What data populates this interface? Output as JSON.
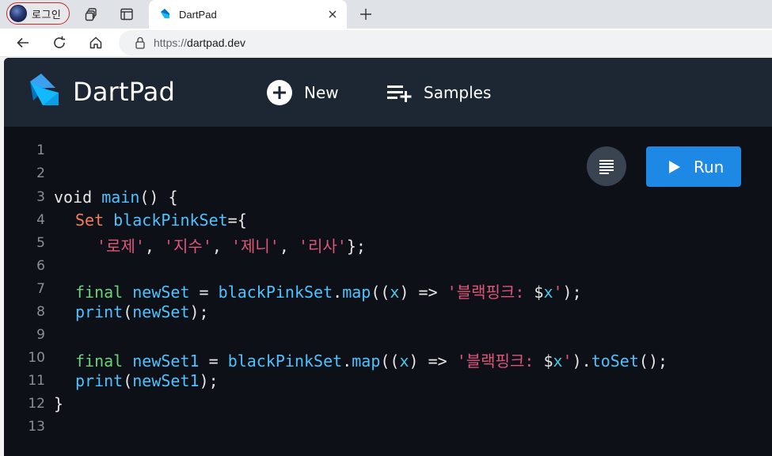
{
  "browser": {
    "profile_label": "로그인",
    "tab": {
      "title": "DartPad"
    },
    "address": {
      "protocol": "https://",
      "host": "dartpad.dev"
    }
  },
  "app": {
    "brand": "DartPad",
    "new_label": "New",
    "samples_label": "Samples",
    "run_label": "Run",
    "colors": {
      "header": "#1c2733",
      "editor": "#0d1117",
      "run": "#1e88e5"
    }
  },
  "editor": {
    "lines": [
      {
        "n": "1"
      },
      {
        "n": "2"
      },
      {
        "n": "3"
      },
      {
        "n": "4"
      },
      {
        "n": "5"
      },
      {
        "n": "6"
      },
      {
        "n": "7"
      },
      {
        "n": "8"
      },
      {
        "n": "9"
      },
      {
        "n": "10"
      },
      {
        "n": "11"
      },
      {
        "n": "12"
      },
      {
        "n": "13"
      }
    ],
    "tokens": {
      "l3": [
        "void",
        " ",
        "main",
        "() {"
      ],
      "l4": [
        "Set",
        " ",
        "blackPinkSet",
        "={"
      ],
      "l5": [
        "'로제'",
        ", ",
        "'지수'",
        ", ",
        "'제니'",
        ", ",
        "'리사'",
        "};"
      ],
      "l7": [
        "final",
        " ",
        "newSet",
        " = ",
        "blackPinkSet",
        ".",
        "map",
        "((",
        "x",
        ") => ",
        "'블랙핑크: ",
        "$",
        "x",
        "'",
        ");"
      ],
      "l8": [
        "print",
        "(",
        "newSet",
        ");"
      ],
      "l10": [
        "final",
        " ",
        "newSet1",
        " = ",
        "blackPinkSet",
        ".",
        "map",
        "((",
        "x",
        ") => ",
        "'블랙핑크: ",
        "$",
        "x",
        "'",
        ").",
        "toSet",
        "();"
      ],
      "l11": [
        "print",
        "(",
        "newSet1",
        ");"
      ],
      "l12": [
        "}"
      ]
    }
  }
}
